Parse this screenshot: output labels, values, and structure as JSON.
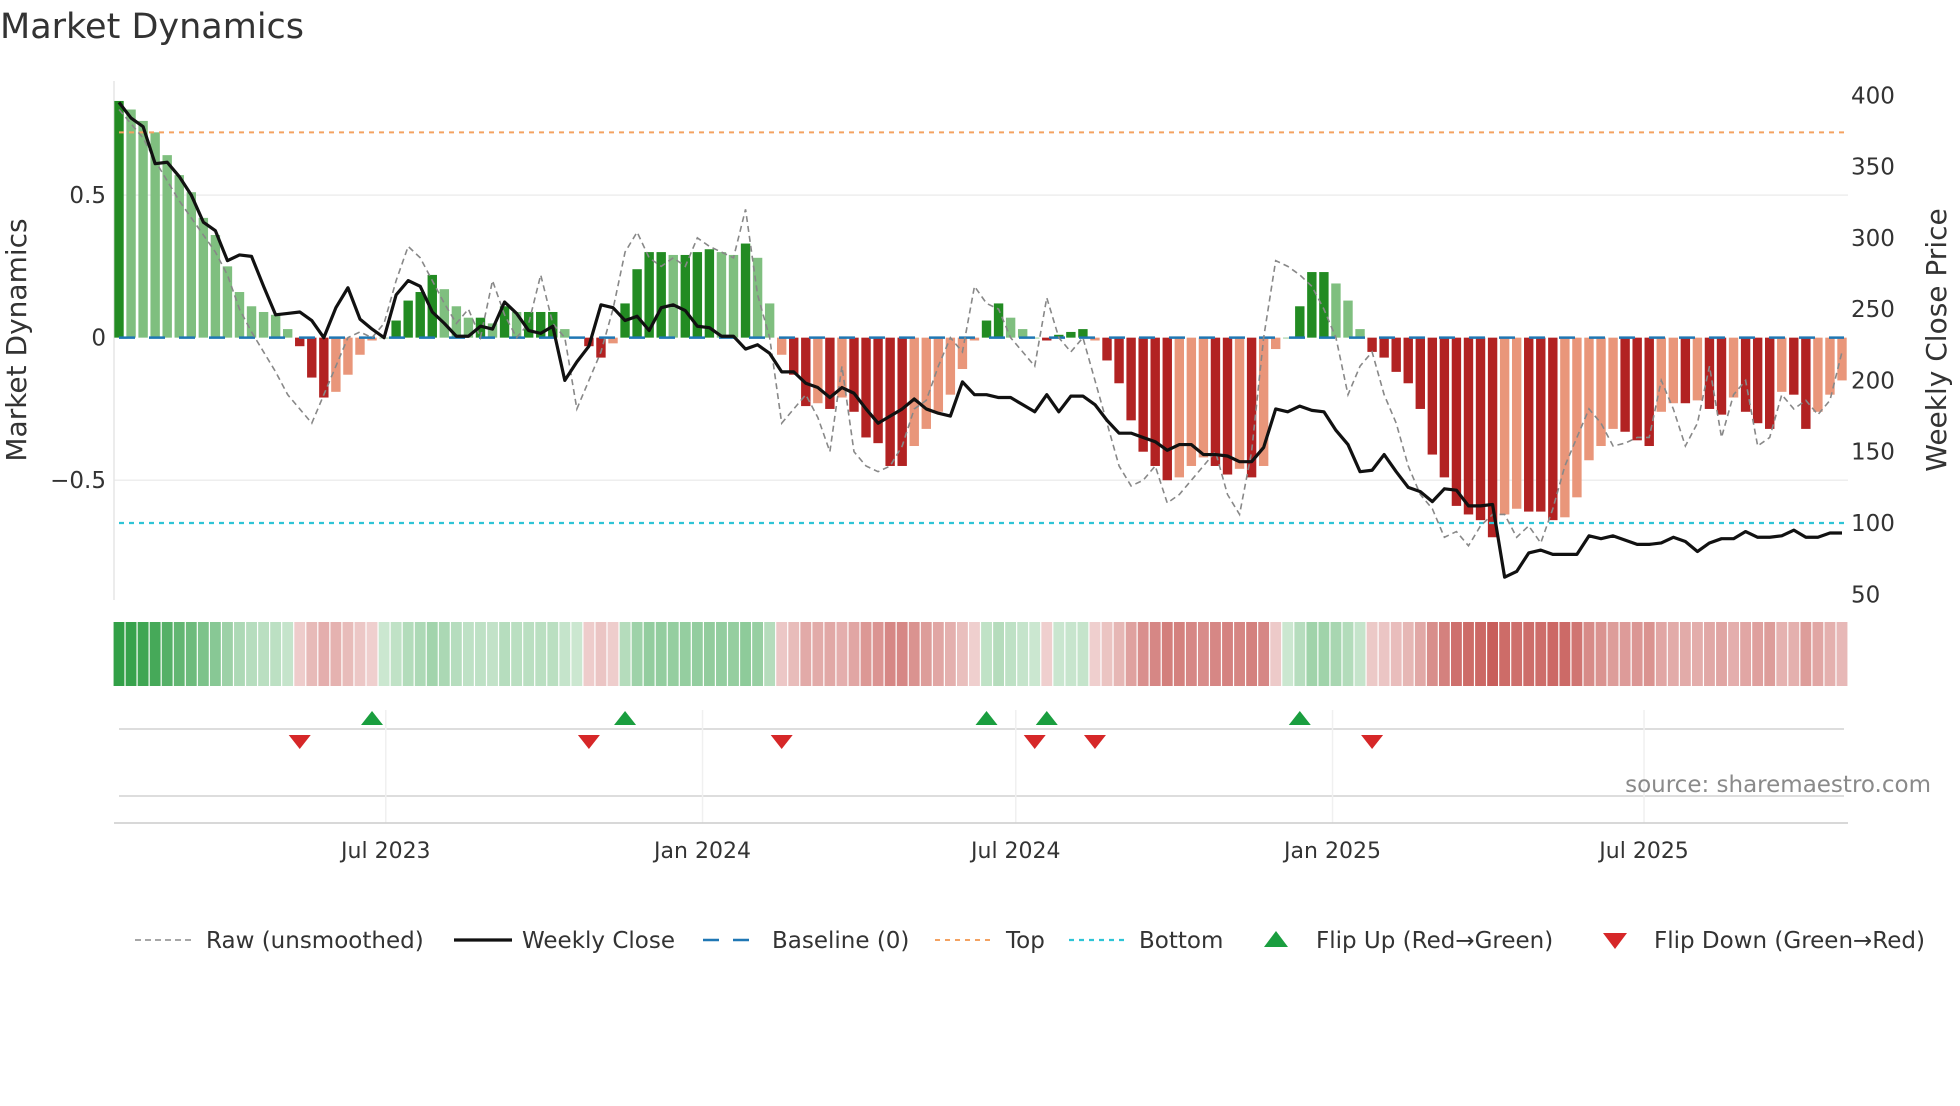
{
  "title": "Market Dynamics",
  "source": "source: sharemaestro.com",
  "chart_data": {
    "type": "bar",
    "title": "Market Dynamics",
    "frequency": "weekly",
    "start_date": "2023-01-27",
    "ylabel": "Market Dynamics",
    "y2label": "Weekly Close Price",
    "ylim": [
      -0.92,
      0.9
    ],
    "y2lim": [
      46,
      410
    ],
    "yticks": [
      {
        "v": 0.5,
        "label": "0.5"
      },
      {
        "v": 0,
        "label": "0"
      },
      {
        "v": -0.5,
        "label": "−0.5"
      }
    ],
    "y2ticks": [
      {
        "v": 400,
        "label": "400"
      },
      {
        "v": 350,
        "label": "350"
      },
      {
        "v": 300,
        "label": "300"
      },
      {
        "v": 250,
        "label": "250"
      },
      {
        "v": 200,
        "label": "200"
      },
      {
        "v": 150,
        "label": "150"
      },
      {
        "v": 100,
        "label": "100"
      },
      {
        "v": 50,
        "label": "50"
      }
    ],
    "xticks": [
      {
        "date": "2023-07-01",
        "label": "Jul 2023"
      },
      {
        "date": "2024-01-01",
        "label": "Jan 2024"
      },
      {
        "date": "2024-07-01",
        "label": "Jul 2024"
      },
      {
        "date": "2025-01-01",
        "label": "Jan 2025"
      },
      {
        "date": "2025-07-01",
        "label": "Jul 2025"
      }
    ],
    "top": 0.72,
    "bottom": -0.65,
    "baseline": 0,
    "colors": {
      "green_dark": "#228b22",
      "green_light": "#7fbf7f",
      "red_dark": "#b22222",
      "red_light": "#e9967a",
      "close": "#111111",
      "raw": "#888888",
      "baseline": "#1f77b4",
      "top": "#f4a261",
      "bottom": "#2ec4d6",
      "flip_up": "#1a9e3f",
      "flip_down": "#d62728"
    },
    "momentum": [
      0.83,
      0.8,
      0.76,
      0.72,
      0.64,
      0.57,
      0.51,
      0.42,
      0.36,
      0.25,
      0.16,
      0.11,
      0.09,
      0.08,
      0.03,
      -0.03,
      -0.14,
      -0.21,
      -0.19,
      -0.13,
      -0.06,
      -0.01,
      0.0,
      0.06,
      0.13,
      0.16,
      0.22,
      0.17,
      0.11,
      0.07,
      0.07,
      0.05,
      0.11,
      0.09,
      0.09,
      0.09,
      0.09,
      0.03,
      0.0,
      -0.03,
      -0.07,
      -0.02,
      0.12,
      0.24,
      0.3,
      0.3,
      0.29,
      0.29,
      0.3,
      0.31,
      0.3,
      0.29,
      0.33,
      0.28,
      0.12,
      -0.06,
      -0.13,
      -0.24,
      -0.23,
      -0.25,
      -0.21,
      -0.26,
      -0.35,
      -0.37,
      -0.45,
      -0.45,
      -0.38,
      -0.32,
      -0.26,
      -0.2,
      -0.11,
      -0.01,
      0.06,
      0.12,
      0.07,
      0.03,
      0.0,
      -0.01,
      0.01,
      0.02,
      0.03,
      -0.01,
      -0.08,
      -0.16,
      -0.29,
      -0.4,
      -0.45,
      -0.5,
      -0.49,
      -0.45,
      -0.42,
      -0.45,
      -0.48,
      -0.46,
      -0.49,
      -0.45,
      -0.04,
      0.0,
      0.11,
      0.23,
      0.23,
      0.19,
      0.13,
      0.03,
      -0.05,
      -0.07,
      -0.12,
      -0.16,
      -0.25,
      -0.41,
      -0.49,
      -0.59,
      -0.62,
      -0.64,
      -0.7,
      -0.62,
      -0.6,
      -0.61,
      -0.61,
      -0.64,
      -0.63,
      -0.56,
      -0.43,
      -0.38,
      -0.32,
      -0.33,
      -0.36,
      -0.38,
      -0.26,
      -0.23,
      -0.23,
      -0.22,
      -0.25,
      -0.27,
      -0.21,
      -0.26,
      -0.3,
      -0.32,
      -0.19,
      -0.2,
      -0.32,
      -0.26,
      -0.2,
      -0.15
    ],
    "raw": [
      0.8,
      0.75,
      0.7,
      0.62,
      0.55,
      0.48,
      0.42,
      0.36,
      0.3,
      0.22,
      0.1,
      0.02,
      -0.05,
      -0.12,
      -0.2,
      -0.25,
      -0.3,
      -0.2,
      -0.1,
      0.0,
      0.02,
      0.0,
      0.05,
      0.2,
      0.32,
      0.28,
      0.2,
      0.12,
      0.05,
      0.1,
      0.0,
      0.2,
      0.08,
      0.0,
      0.05,
      0.22,
      0.05,
      0.0,
      -0.25,
      -0.15,
      -0.05,
      0.1,
      0.3,
      0.37,
      0.28,
      0.25,
      0.28,
      0.25,
      0.35,
      0.32,
      0.3,
      0.28,
      0.45,
      0.15,
      0.0,
      -0.3,
      -0.25,
      -0.2,
      -0.28,
      -0.4,
      -0.1,
      -0.4,
      -0.45,
      -0.47,
      -0.45,
      -0.38,
      -0.25,
      -0.22,
      -0.1,
      0.0,
      -0.05,
      0.18,
      0.12,
      0.1,
      0.0,
      -0.05,
      -0.1,
      0.14,
      0.0,
      -0.05,
      0.0,
      -0.15,
      -0.3,
      -0.45,
      -0.52,
      -0.5,
      -0.45,
      -0.58,
      -0.55,
      -0.5,
      -0.45,
      -0.4,
      -0.55,
      -0.62,
      -0.4,
      0.0,
      0.27,
      0.25,
      0.22,
      0.18,
      0.1,
      0.0,
      -0.2,
      -0.1,
      -0.05,
      -0.2,
      -0.3,
      -0.45,
      -0.55,
      -0.6,
      -0.7,
      -0.68,
      -0.73,
      -0.66,
      -0.62,
      -0.62,
      -0.7,
      -0.66,
      -0.72,
      -0.6,
      -0.45,
      -0.35,
      -0.25,
      -0.3,
      -0.38,
      -0.37,
      -0.35,
      -0.35,
      -0.15,
      -0.25,
      -0.38,
      -0.3,
      -0.1,
      -0.35,
      -0.2,
      -0.15,
      -0.38,
      -0.35,
      -0.2,
      -0.25,
      -0.22,
      -0.27,
      -0.22,
      -0.05
    ],
    "weekly_close": [
      395,
      384,
      378,
      352,
      353,
      343,
      330,
      311,
      305,
      284,
      288,
      287,
      266,
      246,
      247,
      248,
      242,
      230,
      251,
      265,
      243,
      236,
      230,
      260,
      270,
      266,
      248,
      240,
      231,
      231,
      238,
      236,
      255,
      247,
      235,
      233,
      238,
      200,
      213,
      224,
      253,
      251,
      242,
      245,
      235,
      251,
      253,
      249,
      238,
      237,
      231,
      231,
      222,
      225,
      219,
      206,
      206,
      198,
      195,
      188,
      195,
      191,
      180,
      170,
      175,
      180,
      187,
      180,
      177,
      175,
      199,
      190,
      190,
      188,
      188,
      183,
      178,
      190,
      178,
      189,
      189,
      183,
      172,
      163,
      163,
      160,
      157,
      151,
      155,
      155,
      148,
      148,
      147,
      143,
      143,
      153,
      180,
      178,
      182,
      179,
      178,
      165,
      155,
      136,
      137,
      148,
      136,
      125,
      122,
      115,
      124,
      123,
      112,
      112,
      113,
      62,
      66,
      79,
      81,
      78,
      78,
      78,
      91,
      89,
      91,
      88,
      85,
      85,
      86,
      90,
      87,
      80,
      86,
      89,
      89,
      94,
      90,
      90,
      91,
      95,
      90,
      90,
      93,
      93
    ],
    "flip_up": [
      "2023-06-23",
      "2023-11-17",
      "2024-06-14",
      "2024-07-19",
      "2024-12-13"
    ],
    "flip_down": [
      "2023-05-12",
      "2023-10-27",
      "2024-02-16",
      "2024-07-12",
      "2024-08-16",
      "2025-01-24"
    ],
    "legend": {
      "placement": "bottom",
      "items": [
        {
          "key": "raw",
          "label": "Raw (unsmoothed)"
        },
        {
          "key": "close",
          "label": "Weekly Close"
        },
        {
          "key": "baseline",
          "label": "Baseline (0)"
        },
        {
          "key": "top",
          "label": "Top"
        },
        {
          "key": "bottom",
          "label": "Bottom"
        },
        {
          "key": "flip_up",
          "label": "Flip Up (Red→Green)"
        },
        {
          "key": "flip_down",
          "label": "Flip Down (Green→Red)"
        }
      ]
    }
  }
}
